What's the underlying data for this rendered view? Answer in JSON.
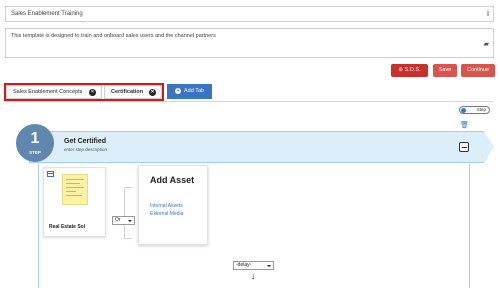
{
  "header": {
    "title_value": "Sales Enablement Training",
    "description_value": "This template is designed to train and onboard sales users and the channel partners"
  },
  "toolbar": {
    "sos_label": "S.O.S.",
    "save_label": "Save",
    "continue_label": "Continue"
  },
  "tabs": [
    {
      "label": "Sales Enablement Concepts"
    },
    {
      "label": "Certification"
    }
  ],
  "add_tab_label": "Add Tab",
  "toggle_label": "Step",
  "step": {
    "number": "1",
    "badge_label": "STEP",
    "title": "Get Certified",
    "description_placeholder": "enter step description"
  },
  "asset": {
    "label": "Real Estate Sol"
  },
  "or_select": {
    "selected": "Or"
  },
  "add_asset": {
    "title": "Add Asset",
    "links": [
      "Internal Assets",
      "External Media"
    ]
  },
  "delay_select": {
    "selected": "-delay-"
  },
  "colors": {
    "accent_blue": "#3a75c4",
    "danger_red": "#d9534f",
    "step_banner": "#dbeefa",
    "step_circle": "#5f87b0",
    "highlight_outline": "#d01b1b"
  }
}
